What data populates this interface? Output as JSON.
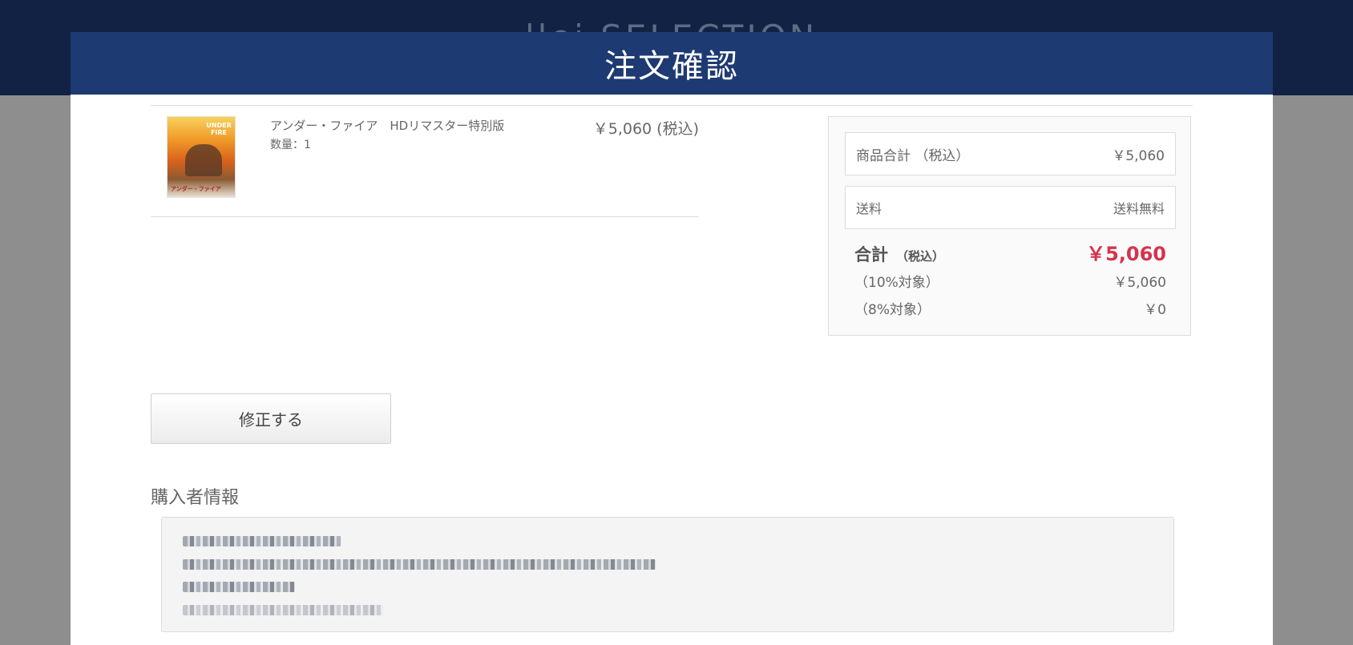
{
  "background_header": {
    "logo_text": "llei    SELECTION"
  },
  "modal": {
    "title": "注文確認"
  },
  "cart_item": {
    "thumbnail_title": "UNDER FIRE",
    "thumbnail_caption": "アンダー・ファイア",
    "name": "アンダー・ファイア　HDリマスター特別版",
    "quantity": "数量：1",
    "price": "￥5,060 (税込)"
  },
  "summary": {
    "subtotal_label": "商品合計 （税込）",
    "subtotal_value": "￥5,060",
    "shipping_label": "送料",
    "shipping_value": "送料無料",
    "total_label": "合計",
    "total_tax_note": "（税込）",
    "total_value": "￥5,060",
    "tax10_label": "（10%対象）",
    "tax10_value": "￥5,060",
    "tax8_label": "（8%対象）",
    "tax8_value": "￥0"
  },
  "actions": {
    "edit_label": "修正する"
  },
  "buyer_info": {
    "heading": "購入者情報"
  },
  "colors": {
    "header_navy": "#1e3a72",
    "page_navy": "#112244",
    "total_red": "#d6334c"
  }
}
